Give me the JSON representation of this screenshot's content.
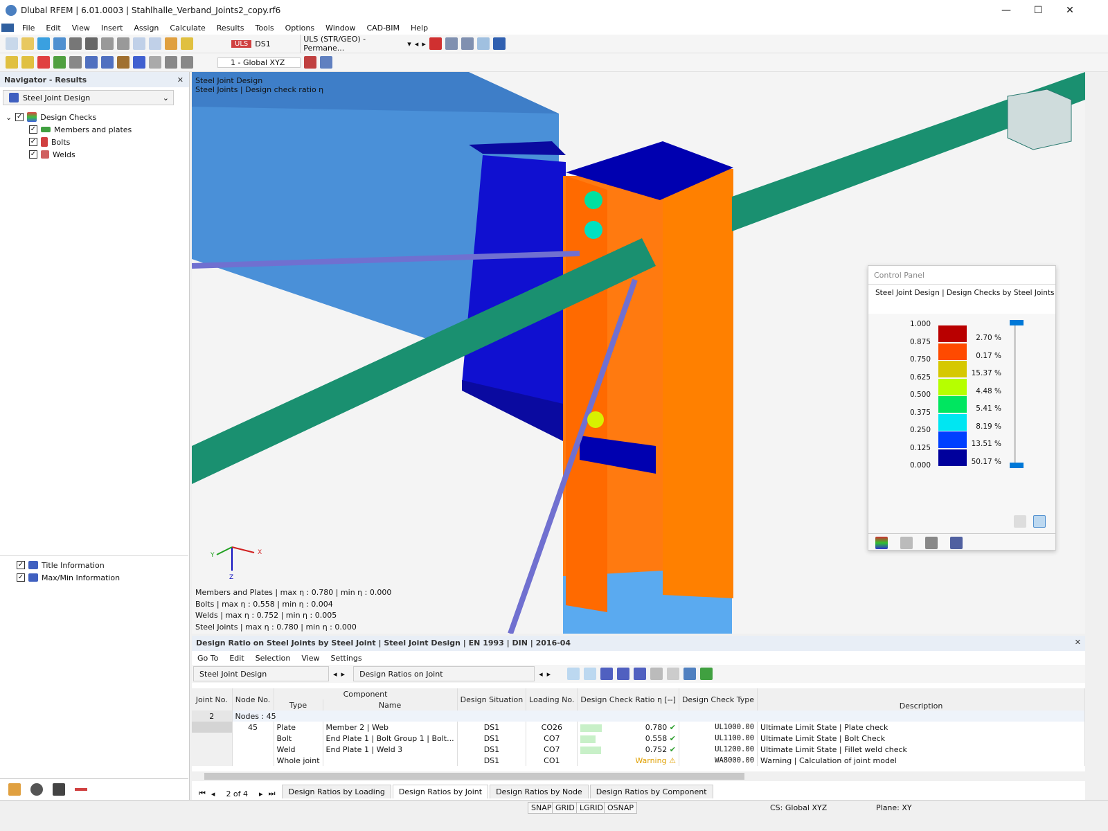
{
  "window": {
    "title": "Dlubal RFEM | 6.01.0003 | Stahlhalle_Verband_Joints2_copy.rf6",
    "min": "—",
    "max": "☐",
    "close": "✕"
  },
  "menu": [
    "File",
    "Edit",
    "View",
    "Insert",
    "Assign",
    "Calculate",
    "Results",
    "Tools",
    "Options",
    "Window",
    "CAD-BIM",
    "Help"
  ],
  "toolbar": {
    "uls_badge": "ULS",
    "design_situation": "DS1",
    "combo": "ULS (STR/GEO) - Permane...",
    "coord_system": "1 - Global XYZ"
  },
  "navigator": {
    "title": "Navigator - Results",
    "dropdown": "Steel Joint Design",
    "tree": [
      {
        "label": "Design Checks",
        "checked": true,
        "children": [
          {
            "label": "Members and plates",
            "checked": true
          },
          {
            "label": "Bolts",
            "checked": true
          },
          {
            "label": "Welds",
            "checked": true
          }
        ]
      }
    ],
    "bottom_items": [
      {
        "label": "Title Information",
        "checked": true
      },
      {
        "label": "Max/Min Information",
        "checked": true
      }
    ]
  },
  "viewport": {
    "header_line1": "Steel Joint Design",
    "header_line2": "Steel Joints | Design check ratio η",
    "axes": {
      "x": "X",
      "y": "Y",
      "z": "Z"
    },
    "summary": [
      "Members and Plates | max η : 0.780 | min η : 0.000",
      "Bolts | max η : 0.558 | min η : 0.004",
      "Welds | max η : 0.752 | min η : 0.005",
      "Steel Joints | max η : 0.780 | min η : 0.000"
    ]
  },
  "control_panel": {
    "title": "Control Panel",
    "subtitle": "Steel Joint Design | Design Checks by Steel Joints",
    "scale_values": [
      "1.000",
      "0.875",
      "0.750",
      "0.625",
      "0.500",
      "0.375",
      "0.250",
      "0.125",
      "0.000"
    ],
    "bands": [
      {
        "color": "#b90000",
        "percent": "2.70 %"
      },
      {
        "color": "#ff4a00",
        "percent": "0.17 %"
      },
      {
        "color": "#d6c800",
        "percent": "15.37 %"
      },
      {
        "color": "#b6ff00",
        "percent": "4.48 %"
      },
      {
        "color": "#00e660",
        "percent": "5.41 %"
      },
      {
        "color": "#00e6f2",
        "percent": "8.19 %"
      },
      {
        "color": "#0040ff",
        "percent": "13.51 %"
      },
      {
        "color": "#00009c",
        "percent": "50.17 %"
      }
    ]
  },
  "table_panel": {
    "title": "Design Ratio on Steel Joints by Steel Joint | Steel Joint Design | EN 1993 | DIN | 2016-04",
    "menu": [
      "Go To",
      "Edit",
      "Selection",
      "View",
      "Settings"
    ],
    "dropdown1": "Steel Joint Design",
    "dropdown2": "Design Ratios on Joint",
    "headers": {
      "joint": "Joint No.",
      "node": "Node No.",
      "component": "Component",
      "type": "Type",
      "name": "Name",
      "situation": "Design Situation",
      "loading": "Loading No.",
      "ratio": "Design Check Ratio η [--]",
      "check_type": "Design Check Type",
      "description": "Description"
    },
    "group": {
      "joint": "2",
      "label": "Nodes : 45"
    },
    "rows": [
      {
        "node": "45",
        "type": "Plate",
        "name": "Member 2 | Web",
        "situation": "DS1",
        "loading": "CO26",
        "ratio": "0.780",
        "ratio_value": 0.78,
        "status": "✔",
        "check_type": "UL1000.00",
        "description": "Ultimate Limit State | Plate check"
      },
      {
        "node": "",
        "type": "Bolt",
        "name": "End Plate 1 | Bolt Group 1 | Bolt...",
        "situation": "DS1",
        "loading": "CO7",
        "ratio": "0.558",
        "ratio_value": 0.558,
        "status": "✔",
        "check_type": "UL1100.00",
        "description": "Ultimate Limit State | Bolt Check"
      },
      {
        "node": "",
        "type": "Weld",
        "name": "End Plate 1 | Weld 3",
        "situation": "DS1",
        "loading": "CO7",
        "ratio": "0.752",
        "ratio_value": 0.752,
        "status": "✔",
        "check_type": "UL1200.00",
        "description": "Ultimate Limit State | Fillet weld check"
      },
      {
        "node": "",
        "type": "Whole joint",
        "name": "",
        "situation": "DS1",
        "loading": "CO1",
        "ratio": "Warning",
        "ratio_value": null,
        "status": "⚠",
        "check_type": "WA8000.00",
        "description": "Warning | Calculation of joint model"
      }
    ],
    "pager": "2 of 4",
    "tabs": [
      "Design Ratios by Loading",
      "Design Ratios by Joint",
      "Design Ratios by Node",
      "Design Ratios by Component"
    ],
    "active_tab": 1
  },
  "statusbar": {
    "toggles": [
      "SNAP",
      "GRID",
      "LGRID",
      "OSNAP"
    ],
    "cs": "CS: Global XYZ",
    "plane": "Plane: XY"
  }
}
